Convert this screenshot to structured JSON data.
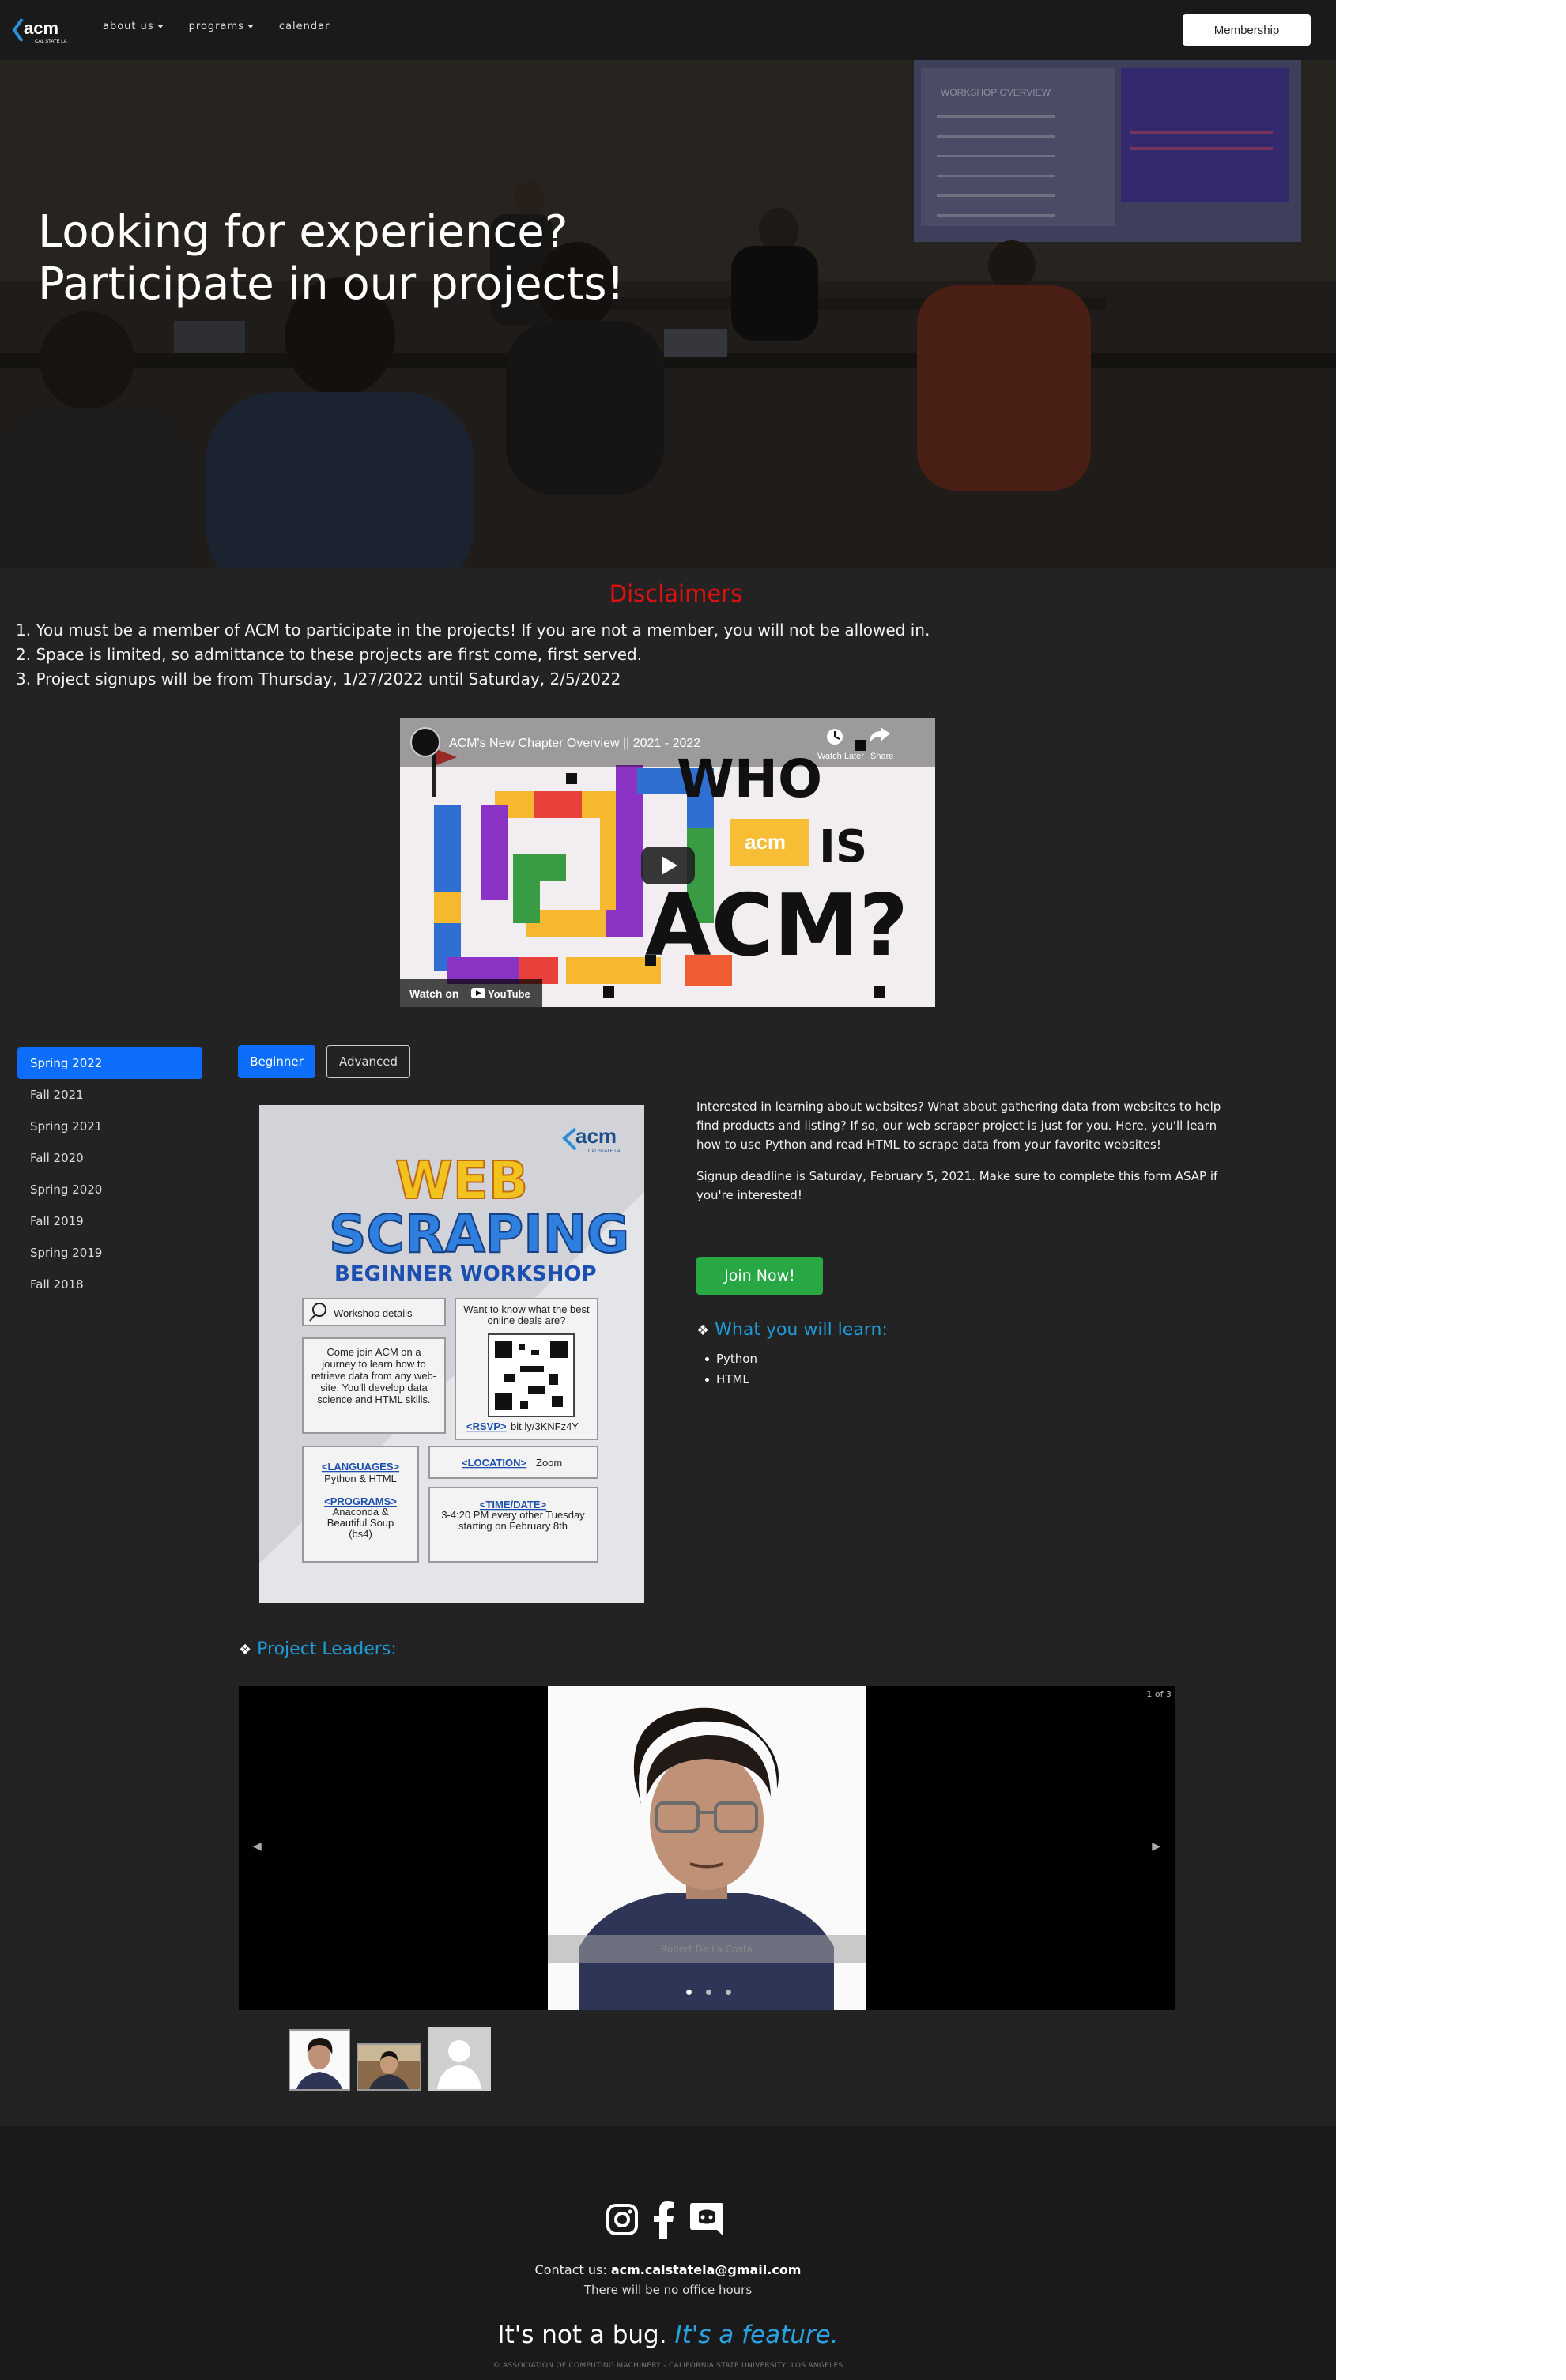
{
  "nav": {
    "logo_text": "acm",
    "logo_sub": "CAL STATE LA",
    "items": [
      "about us",
      "programs",
      "calendar"
    ],
    "membership_label": "Membership"
  },
  "hero": {
    "line1": "Looking for experience?",
    "line2": "Participate in our projects!",
    "projector_heading": "WORKSHOP OVERVIEW"
  },
  "disclaimers": {
    "title": "Disclaimers",
    "items": [
      "1. You must be a member of ACM to participate in the projects! If you are not a member, you will not be allowed in.",
      "2. Space is limited, so admittance to these projects are first come, first served.",
      "3. Project signups will be from Thursday, 1/27/2022 until Saturday, 2/5/2022"
    ]
  },
  "video": {
    "title": "ACM's New Chapter Overview || 2021 - 2022",
    "watch_later": "Watch Later",
    "share": "Share",
    "watch_on": "Watch on",
    "youtube": "YouTube",
    "big_text_1": "WHO",
    "big_text_2": "IS",
    "big_text_3": "ACM?",
    "badge_text": "acm"
  },
  "semesters": {
    "items": [
      "Spring 2022",
      "Fall 2021",
      "Spring 2021",
      "Fall 2020",
      "Spring 2020",
      "Fall 2019",
      "Spring 2019",
      "Fall 2018"
    ],
    "active_index": 0
  },
  "levels": {
    "beginner": "Beginner",
    "advanced": "Advanced"
  },
  "poster": {
    "logo_text": "acm",
    "logo_sub": "CAL STATE LA",
    "title_1": "WEB",
    "title_2": "SCRAPING",
    "subtitle": "BEGINNER WORKSHOP",
    "search_text": "Workshop details",
    "deals_text": "Want to know what the best online deals are?",
    "join_text": "Come join ACM on a journey to learn how to retrieve data from any web- site. You'll develop data science and HTML skills.",
    "rsvp_label": "<RSVP>",
    "rsvp_value": "bit.ly/3KNFz4Y",
    "languages_label": "<LANGUAGES>",
    "languages_value": "Python & HTML",
    "programs_label": "<PROGRAMS>",
    "programs_value": "Anaconda & Beautiful Soup (bs4)",
    "location_label": "<LOCATION>",
    "location_value": "Zoom",
    "time_label": "<TIME/DATE>",
    "time_value": "3-4:20 PM every other Tuesday starting on February 8th"
  },
  "project": {
    "paragraph1": "Interested in learning about websites? What about gathering data from websites to help find products and listing? If so, our web scraper project is just for you. Here, you'll learn how to use Python and read HTML to scrape data from your favorite websites!",
    "paragraph2": "Signup deadline is Saturday, February 5, 2021. Make sure to complete this form ASAP if you're interested!",
    "join_label": "Join Now!",
    "learn_heading": "What you will learn:",
    "learn_items": [
      "Python",
      "HTML"
    ],
    "leaders_heading": "Project Leaders:"
  },
  "carousel": {
    "counter": "1 of 3",
    "caption": "Robert De La Costa",
    "prev_icon": "◀",
    "next_icon": "▶"
  },
  "footer": {
    "contact_label": "Contact us:",
    "contact_email": "acm.calstatela@gmail.com",
    "hours": "There will be no office hours",
    "motto_plain": "It's not a bug.",
    "motto_accent": "It's a feature.",
    "copyright": "© ASSOCIATION OF COMPUTING MACHINERY - CALIFORNIA STATE UNIVERSITY, LOS ANGELES"
  },
  "colors": {
    "accent_blue": "#0d6efd",
    "heading_blue": "#1e9cd8",
    "disclaimer_red": "#e0100f",
    "join_green": "#28a745"
  }
}
